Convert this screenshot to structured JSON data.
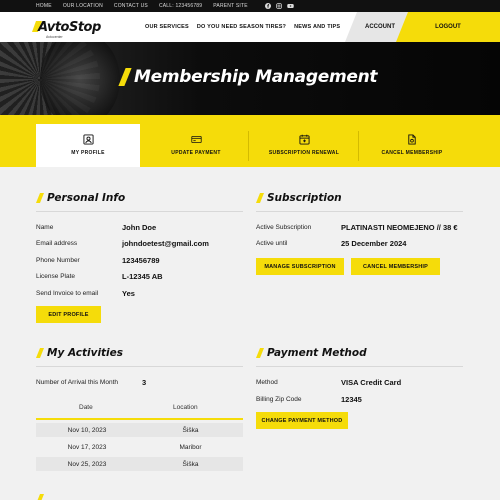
{
  "topbar": {
    "links": [
      "HOME",
      "OUR LOCATION",
      "CONTACT US",
      "CALL: 123456789",
      "PARENT SITE"
    ],
    "social_icons": [
      "facebook-icon",
      "instagram-icon",
      "youtube-icon"
    ]
  },
  "nav": {
    "logo": "AvtoStop",
    "logo_sub": "Avtocenter",
    "links": [
      "OUR SERVICES",
      "DO YOU NEED SEASON TIRES?",
      "NEWS AND TIPS"
    ],
    "account": "ACCOUNT",
    "logout": "LOGOUT"
  },
  "hero": {
    "title": "Membership Management"
  },
  "tabs": [
    {
      "label": "MY PROFILE",
      "icon": "profile-icon",
      "active": true
    },
    {
      "label": "UPDATE PAYMENT",
      "icon": "credit-card-icon",
      "active": false
    },
    {
      "label": "SUBSCRIPTION RENEWAL",
      "icon": "calendar-icon",
      "active": false
    },
    {
      "label": "CANCEL MEMBERSHIP",
      "icon": "document-icon",
      "active": false
    }
  ],
  "personal": {
    "title": "Personal Info",
    "rows": [
      {
        "label": "Name",
        "value": "John Doe"
      },
      {
        "label": "Email address",
        "value": "johndoetest@gmail.com"
      },
      {
        "label": "Phone Number",
        "value": "123456789"
      },
      {
        "label": "License Plate",
        "value": "L-12345 AB"
      },
      {
        "label": "Send Invoice to email",
        "value": "Yes"
      }
    ],
    "button": "EDIT PROFILE"
  },
  "subscription": {
    "title": "Subscription",
    "rows": [
      {
        "label": "Active Subscription",
        "value": "PLATINASTI  NEOMEJENO // 38 €"
      },
      {
        "label": "Active until",
        "value": "25 December 2024"
      }
    ],
    "manage_button": "MANAGE SUBSCRIPTION",
    "cancel_button": "CANCEL MEMBERSHIP"
  },
  "activities": {
    "title": "My Activities",
    "arrival_label": "Number of Arrival this Month",
    "arrival_value": "3",
    "columns": [
      "Date",
      "Location"
    ],
    "rows": [
      {
        "date": "Nov 10, 2023",
        "location": "Šiška"
      },
      {
        "date": "Nov 17, 2023",
        "location": "Maribor"
      },
      {
        "date": "Nov 25, 2023",
        "location": "Šiška"
      }
    ]
  },
  "payment": {
    "title": "Payment Method",
    "rows": [
      {
        "label": "Method",
        "value": "VISA Credit Card"
      },
      {
        "label": "Billing Zip Code",
        "value": "12345"
      }
    ],
    "button": "CHANGE PAYMENT METHOD"
  },
  "colors": {
    "accent": "#f5dc0a",
    "dark": "#111111"
  }
}
